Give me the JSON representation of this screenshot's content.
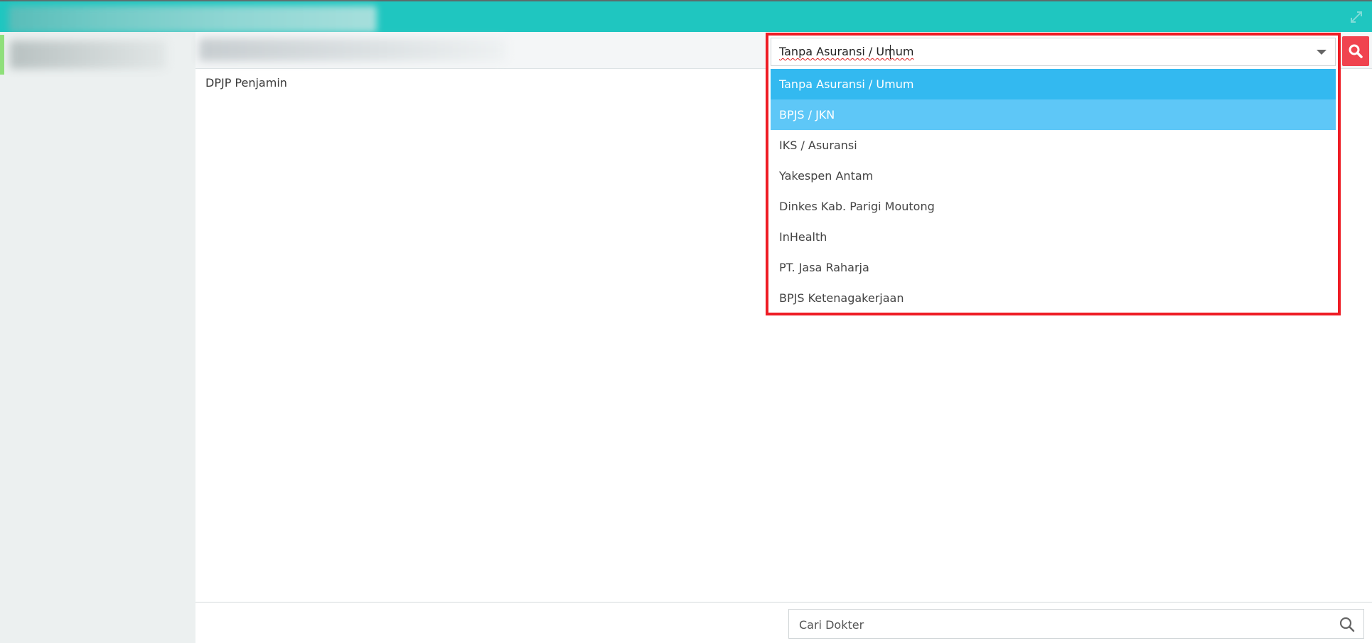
{
  "content": {
    "section_label": "DPJP Penjamin"
  },
  "penjamin_select": {
    "value": "Tanpa Asuransi / Umum",
    "options": [
      "Tanpa Asuransi / Umum",
      "BPJS / JKN",
      "IKS / Asuransi",
      "Yakespen Antam",
      "Dinkes Kab. Parigi Moutong",
      "InHealth",
      "PT. Jasa Raharja",
      "BPJS Ketenagakerjaan"
    ],
    "selected_index": 0,
    "hover_index": 1
  },
  "doctor_search": {
    "placeholder": "Cari Dokter"
  },
  "icons": {
    "search_button": "search-icon",
    "doctor_search": "search-icon",
    "expand": "expand-icon",
    "dropdown": "chevron-down-icon"
  },
  "colors": {
    "topbar": "#1fc6c0",
    "selected_option": "#33b9f0",
    "hover_option": "#5ec7f7",
    "search_button": "#f0434f",
    "highlight_border": "#ee1c24",
    "left_accent": "#8fe07a"
  }
}
